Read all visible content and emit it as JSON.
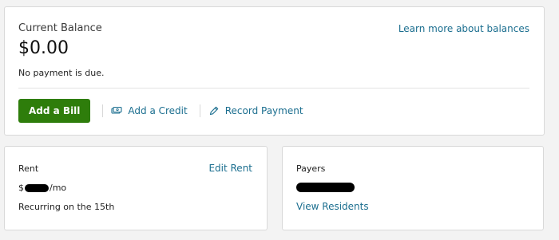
{
  "balance": {
    "label": "Current Balance",
    "amount": "$0.00",
    "note": "No payment is due.",
    "learn_more": "Learn more about balances"
  },
  "actions": {
    "add_bill": "Add a Bill",
    "add_credit": "Add a Credit",
    "record_payment": "Record Payment"
  },
  "rent": {
    "title": "Rent",
    "edit": "Edit Rent",
    "currency": "$",
    "period": "/mo",
    "recurring": "Recurring on the 15th"
  },
  "payers": {
    "title": "Payers",
    "view_residents": "View Residents"
  },
  "colors": {
    "link": "#1b6e8f",
    "primary_button": "#2e7d0b",
    "card_border": "#d9d9d9",
    "page_background": "#f3f3f3"
  },
  "icons": {
    "credit": "credit-bills-icon",
    "record": "pencil-icon"
  }
}
